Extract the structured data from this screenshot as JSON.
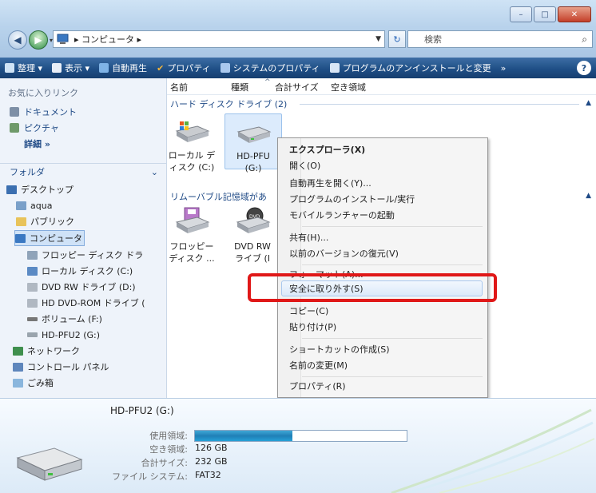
{
  "window": {
    "controls": {
      "minimize": "–",
      "maximize": "□",
      "close": "✕"
    }
  },
  "address": {
    "crumbs": "▸ コンピュータ ▸"
  },
  "search": {
    "placeholder": "検索"
  },
  "toolbar": {
    "organize": "整理 ▾",
    "view": "表示 ▾",
    "autoplay": "自動再生",
    "properties": "プロパティ",
    "system_properties": "システムのプロパティ",
    "uninstall": "プログラムのアンインストールと変更",
    "more": "»",
    "help": "?"
  },
  "left_pane": {
    "favorites_title": "お気に入りリンク",
    "favorites": [
      "ドキュメント",
      "ピクチャ"
    ],
    "more": "詳細 »",
    "folders_title": "フォルダ",
    "tree": [
      {
        "label": "デスクトップ",
        "icon": "desktop-icon"
      },
      {
        "label": "aqua",
        "icon": "user-icon"
      },
      {
        "label": "パブリック",
        "icon": "folder-icon"
      },
      {
        "label": "コンピュータ",
        "icon": "computer-icon",
        "selected": true
      },
      {
        "label": "フロッピー ディスク ドラ",
        "icon": "floppy-icon"
      },
      {
        "label": "ローカル ディスク (C:)",
        "icon": "hdd-icon"
      },
      {
        "label": "DVD RW ドライブ (D:)",
        "icon": "dvd-icon"
      },
      {
        "label": "HD DVD-ROM ドライブ (",
        "icon": "dvd-icon"
      },
      {
        "label": "ボリューム (F:)",
        "icon": "drive-icon"
      },
      {
        "label": "HD-PFU2 (G:)",
        "icon": "drive-icon"
      },
      {
        "label": "ネットワーク",
        "icon": "network-icon"
      },
      {
        "label": "コントロール パネル",
        "icon": "control-panel-icon"
      },
      {
        "label": "ごみ箱",
        "icon": "recycle-bin-icon"
      }
    ]
  },
  "columns": [
    "名前",
    "種類",
    "合計サイズ",
    "空き領域"
  ],
  "groups": {
    "hard_disks": "ハード ディスク ドライブ (2)",
    "removable": "リムーバブル記憶域があ"
  },
  "drives": {
    "local_c": [
      "ローカル デ",
      "ィスク (C:)"
    ],
    "hdpfu": [
      "HD-PFU",
      "(G:)"
    ],
    "floppy": [
      "フロッピー",
      "ディスク ..."
    ],
    "dvd": [
      "DVD RW",
      "ライブ (I"
    ]
  },
  "context_menu": {
    "explorer": "エクスプローラ(X)",
    "open": "開く(O)",
    "autoplay_open": "自動再生を開く(Y)...",
    "install_run": "プログラムのインストール/実行",
    "mobile_launcher": "モバイルランチャーの起動",
    "share": "共有(H)...",
    "restore_previous": "以前のバージョンの復元(V)",
    "format": "フォーマット(A)...",
    "safely_remove": "安全に取り外す(S)",
    "copy": "コピー(C)",
    "paste": "貼り付け(P)",
    "create_shortcut": "ショートカットの作成(S)",
    "rename": "名前の変更(M)",
    "properties": "プロパティ(R)"
  },
  "details": {
    "name": "HD-PFU2 (G:)",
    "used_label": "使用領域:",
    "free_label": "空き領域:",
    "free_value": "126 GB",
    "total_label": "合計サイズ:",
    "total_value": "232 GB",
    "fs_label": "ファイル システム:",
    "fs_value": "FAT32",
    "usage_fraction": 0.46
  }
}
